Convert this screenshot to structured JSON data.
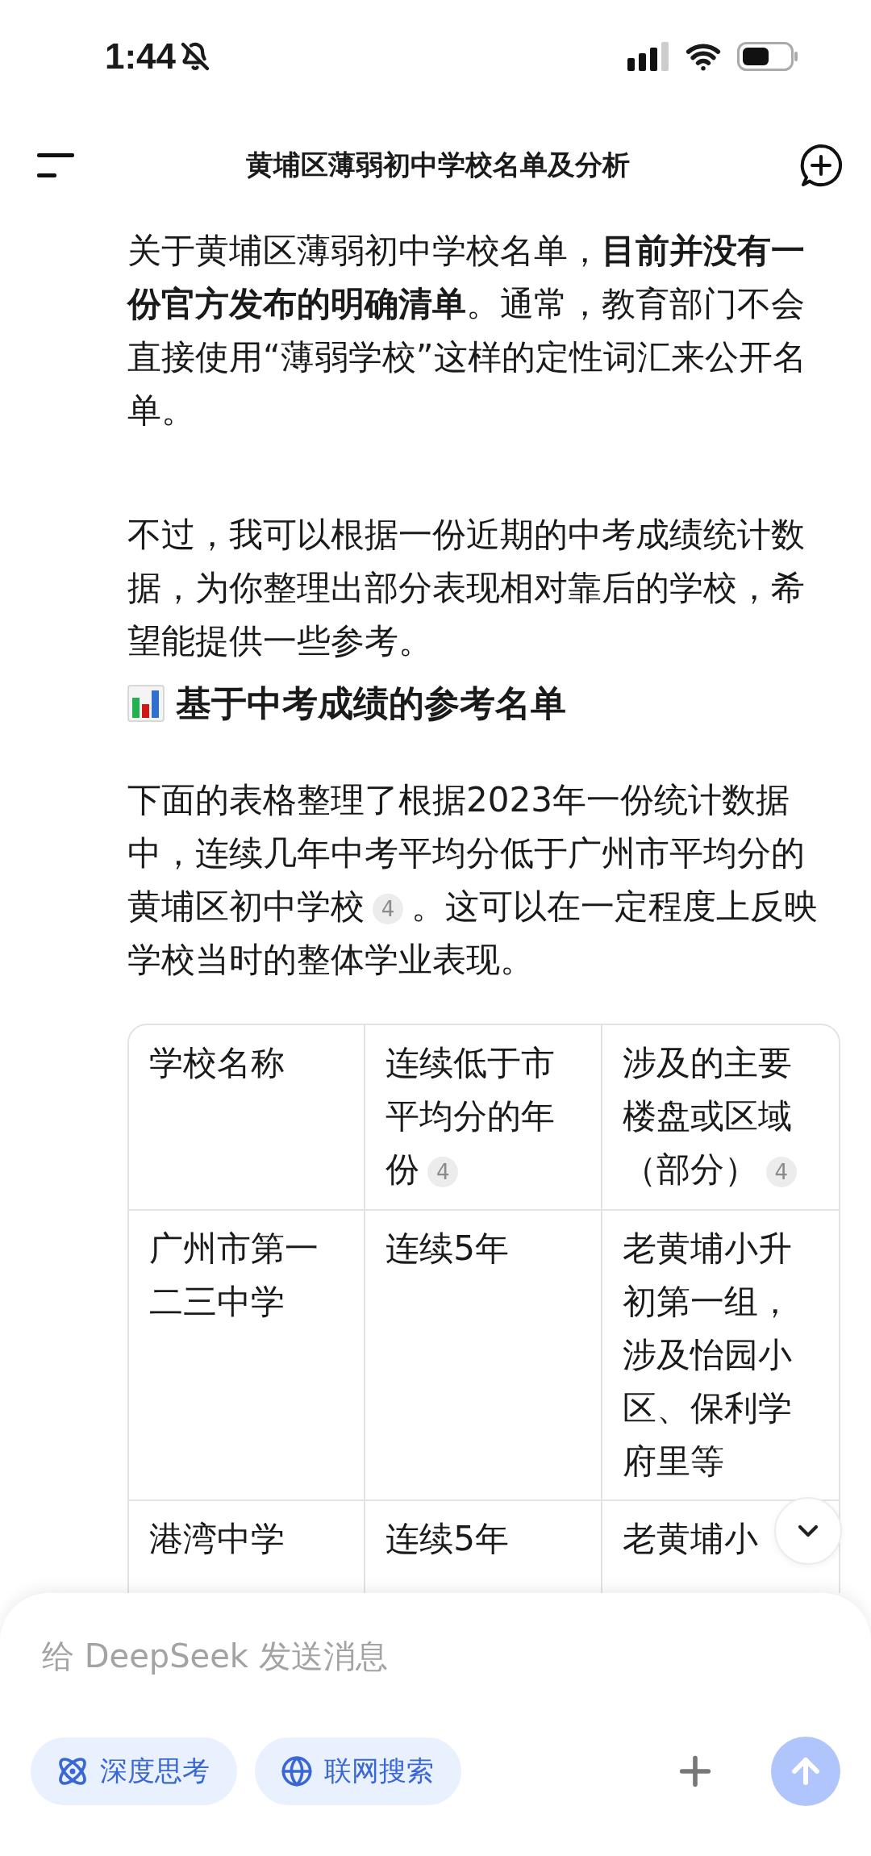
{
  "status_bar": {
    "time": "1:44"
  },
  "header": {
    "title": "黄埔区薄弱初中学校名单及分析"
  },
  "blocks": [
    {
      "kind": "paragraph",
      "segments": [
        {
          "kind": "text",
          "text": "关于黄埔区薄弱初中学校名单，**目前并没有一份官方发布的明确清单**。通常，教育部门不会直接使用“薄弱学校”这样的定性词汇来公开名单。"
        }
      ]
    },
    {
      "kind": "paragraph",
      "segments": [
        {
          "kind": "text",
          "text": "不过，我可以根据一份近期的中考成绩统计数据，为你整理出部分表现相对靠后的学校，希望能提供一些参考。"
        }
      ]
    },
    {
      "kind": "heading",
      "text": "基于中考成绩的参考名单"
    },
    {
      "kind": "paragraph",
      "segments": [
        {
          "kind": "text",
          "text": "下面的表格整理了根据2023年一份统计数据中，连续几年中考平均分低于广州市平均分的黄埔区初中学校"
        },
        {
          "kind": "citation",
          "text": "4"
        },
        {
          "kind": "text",
          "text": "。这可以在一定程度上反映学校当时的整体学业表现。"
        }
      ]
    }
  ],
  "table": {
    "columns": [
      {
        "label": "学校名称"
      },
      {
        "label": "连续低于市平均分的年份",
        "citation": "4"
      },
      {
        "label": "涉及的主要楼盘或区域（部分）",
        "citation": "4"
      }
    ],
    "rows": [
      {
        "cells": [
          "广州市第一二三中学",
          "连续5年",
          "老黄埔小升初第一组，涉及怡园小区、保利学府里等"
        ]
      },
      {
        "cells": [
          "港湾中学",
          "连续5年",
          "老黄埔小"
        ]
      }
    ]
  },
  "composer": {
    "placeholder": "给 DeepSeek 发送消息",
    "toggles": [
      {
        "kind": "think",
        "label": "深度思考",
        "selected": true
      },
      {
        "kind": "search",
        "label": "联网搜索",
        "selected": true
      }
    ]
  }
}
